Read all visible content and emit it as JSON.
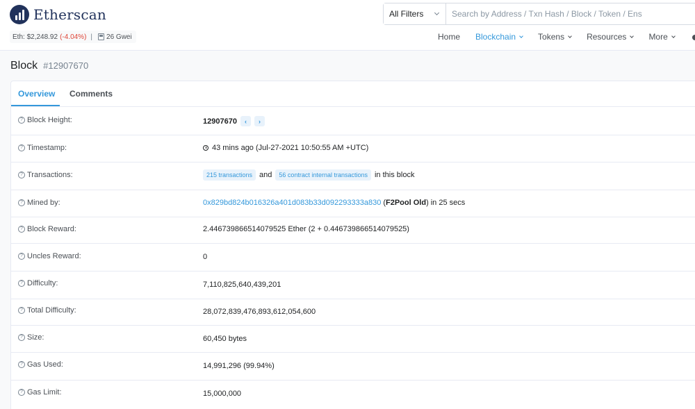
{
  "header": {
    "logo_text": "Etherscan",
    "eth_price": "Eth: $2,248.92",
    "eth_change": "(-4.04%)",
    "separator": "|",
    "gas": "26 Gwei"
  },
  "search": {
    "filter_label": "All Filters",
    "placeholder": "Search by Address / Txn Hash / Block / Token / Ens"
  },
  "nav": {
    "items": [
      {
        "label": "Home"
      },
      {
        "label": "Blockchain"
      },
      {
        "label": "Tokens"
      },
      {
        "label": "Resources"
      },
      {
        "label": "More"
      }
    ]
  },
  "page": {
    "title": "Block",
    "block_number": "#12907670"
  },
  "tabs": [
    {
      "label": "Overview"
    },
    {
      "label": "Comments"
    }
  ],
  "fields": {
    "block_height": {
      "label": "Block Height:",
      "value": "12907670"
    },
    "timestamp": {
      "label": "Timestamp:",
      "value": "43 mins ago (Jul-27-2021 10:50:55 AM +UTC)"
    },
    "transactions": {
      "label": "Transactions:",
      "txns": "215 transactions",
      "and": "and",
      "internal": "56 contract internal transactions",
      "suffix": "in this block"
    },
    "mined_by": {
      "label": "Mined by:",
      "address": "0x829bd824b016326a401d083b33d092293333a830",
      "open": "(",
      "pool": "F2Pool Old",
      "close": ")",
      "suffix": "in 25 secs"
    },
    "block_reward": {
      "label": "Block Reward:",
      "value": "2.446739866514079525 Ether (2 + 0.446739866514079525)"
    },
    "uncles_reward": {
      "label": "Uncles Reward:",
      "value": "0"
    },
    "difficulty": {
      "label": "Difficulty:",
      "value": "7,110,825,640,439,201"
    },
    "total_difficulty": {
      "label": "Total Difficulty:",
      "value": "28,072,839,476,893,612,054,600"
    },
    "size": {
      "label": "Size:",
      "value": "60,450 bytes"
    },
    "gas_used": {
      "label": "Gas Used:",
      "value": "14,991,296 (99.94%)"
    },
    "gas_limit": {
      "label": "Gas Limit:",
      "value": "15,000,000"
    }
  }
}
